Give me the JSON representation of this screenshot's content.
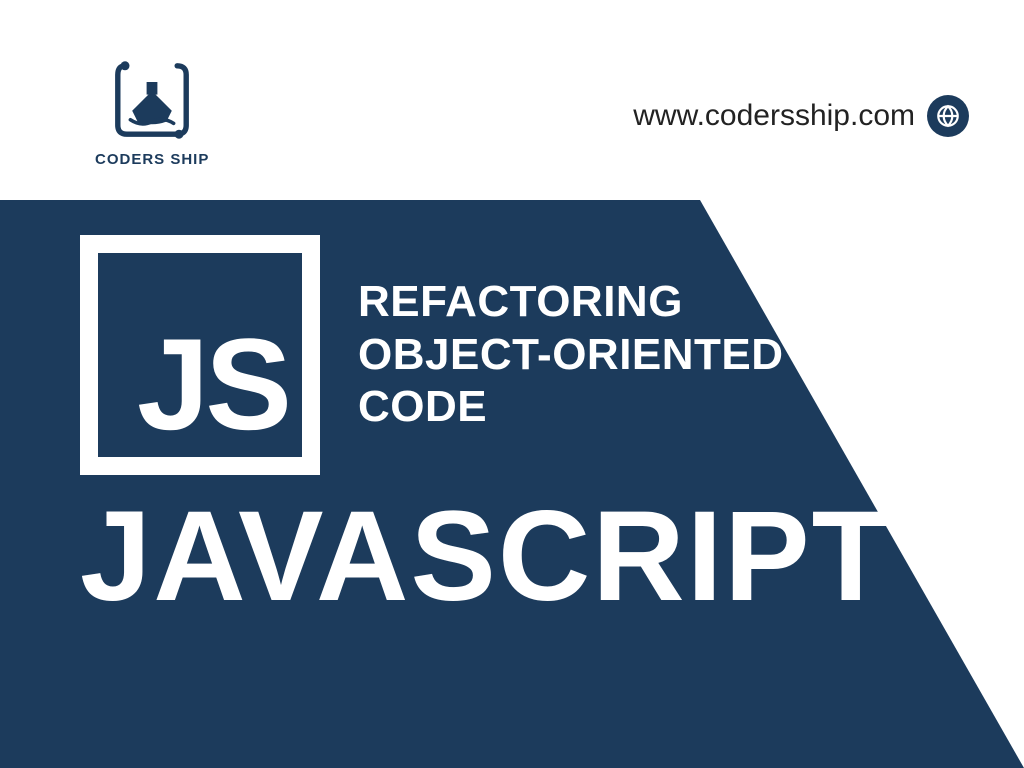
{
  "brand": {
    "name": "CODERS SHIP",
    "url": "www.codersship.com"
  },
  "hero": {
    "js_label": "JS",
    "subtitle_line1": "REFACTORING",
    "subtitle_line2": "OBJECT-ORIENTED",
    "subtitle_line3": "CODE",
    "title": "JAVASCRIPT"
  },
  "colors": {
    "primary": "#1c3b5c",
    "text_on_primary": "#ffffff"
  }
}
